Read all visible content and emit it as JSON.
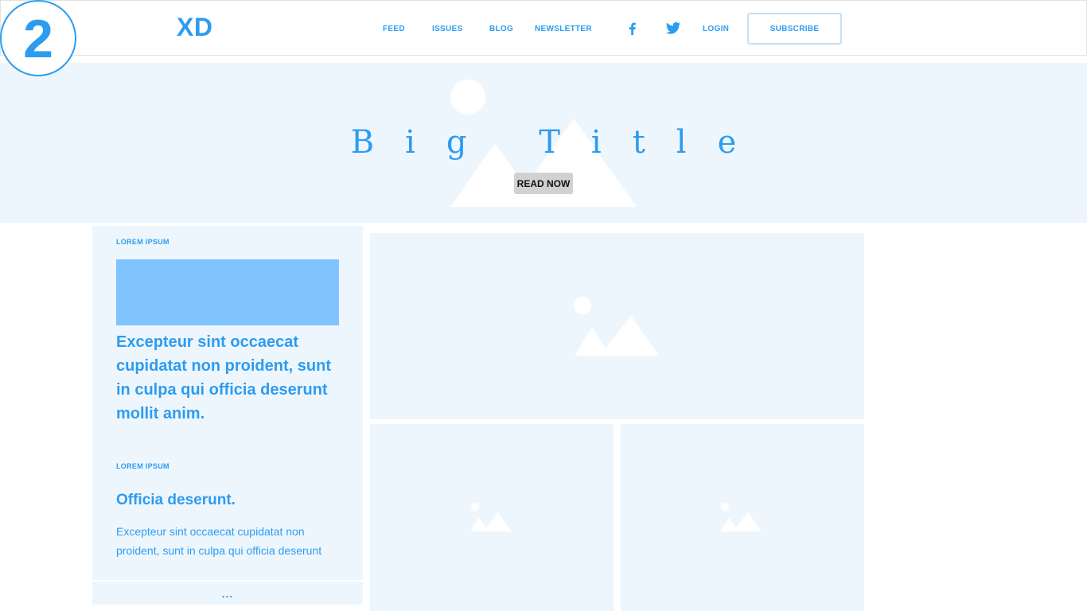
{
  "badge": {
    "number": "2"
  },
  "header": {
    "logo": "XD",
    "nav": [
      "FEED",
      "ISSUES",
      "BLOG",
      "NEWSLETTER"
    ],
    "social": [
      "facebook-icon",
      "twitter-icon"
    ],
    "login": "LOGIN",
    "subscribe": "SUBSCRIBE"
  },
  "hero": {
    "title": "Big Title",
    "button": "READ NOW"
  },
  "sidebar": {
    "kicker_1": "LOREM IPSUM",
    "headline": "Excepteur sint occaecat cupidatat non proident, sunt in culpa qui officia deserunt mollit anim.",
    "kicker_2": "LOREM IPSUM",
    "sub_headline": "Officia deserunt.",
    "excerpt": "Excepteur sint occaecat cupidatat non proident, sunt in culpa qui officia deserunt",
    "more": "..."
  },
  "colors": {
    "accent": "#2d9cf0",
    "hero_bg": "#eef6fd",
    "image_placeholder": "#80c4fd",
    "button_gray": "#d1d1d1"
  },
  "icons": {
    "placeholder": "image-placeholder-icon"
  }
}
